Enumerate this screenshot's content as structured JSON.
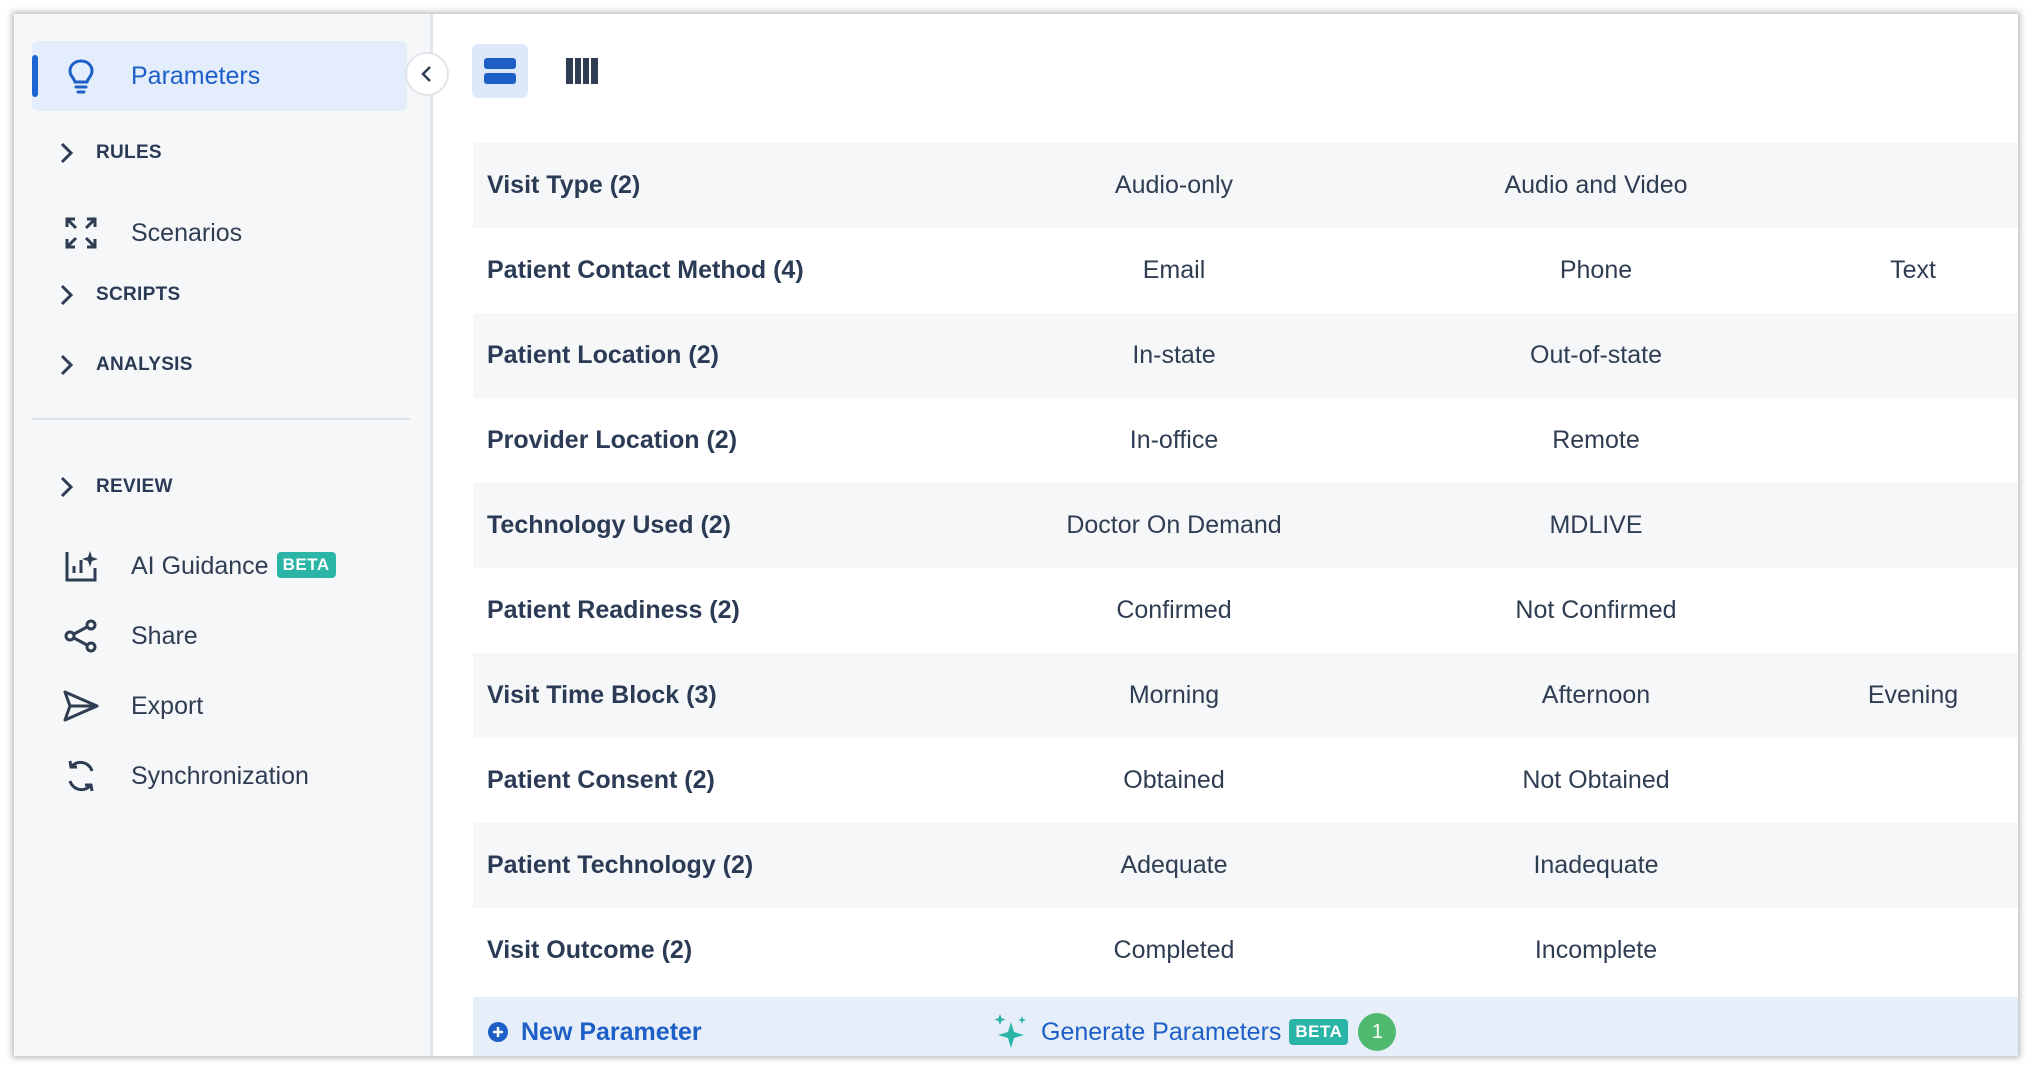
{
  "sidebar": {
    "parameters_label": "Parameters",
    "rules_label": "RULES",
    "scenarios_label": "Scenarios",
    "scripts_label": "SCRIPTS",
    "analysis_label": "ANALYSIS",
    "review_label": "REVIEW",
    "ai_guidance_label": "AI Guidance",
    "ai_guidance_badge": "BETA",
    "share_label": "Share",
    "export_label": "Export",
    "sync_label": "Synchronization"
  },
  "parameters": [
    {
      "name": "Visit Type (2)",
      "values": [
        "Audio-only",
        "Audio and Video",
        ""
      ]
    },
    {
      "name": "Patient Contact Method (4)",
      "values": [
        "Email",
        "Phone",
        "Text"
      ]
    },
    {
      "name": "Patient Location (2)",
      "values": [
        "In-state",
        "Out-of-state",
        ""
      ]
    },
    {
      "name": "Provider Location (2)",
      "values": [
        "In-office",
        "Remote",
        ""
      ]
    },
    {
      "name": "Technology Used (2)",
      "values": [
        "Doctor On Demand",
        "MDLIVE",
        ""
      ]
    },
    {
      "name": "Patient Readiness (2)",
      "values": [
        "Confirmed",
        "Not Confirmed",
        ""
      ]
    },
    {
      "name": "Visit Time Block (3)",
      "values": [
        "Morning",
        "Afternoon",
        "Evening"
      ]
    },
    {
      "name": "Patient Consent (2)",
      "values": [
        "Obtained",
        "Not Obtained",
        ""
      ]
    },
    {
      "name": "Patient Technology (2)",
      "values": [
        "Adequate",
        "Inadequate",
        ""
      ]
    },
    {
      "name": "Visit Outcome (2)",
      "values": [
        "Completed",
        "Incomplete",
        ""
      ]
    }
  ],
  "footer": {
    "new_parameter_label": "New Parameter",
    "generate_label": "Generate Parameters",
    "generate_badge": "BETA",
    "generate_count": "1"
  },
  "colors": {
    "accent": "#1d5fc7",
    "badge_teal": "#2bb5a6",
    "count_green": "#4fba6f"
  }
}
